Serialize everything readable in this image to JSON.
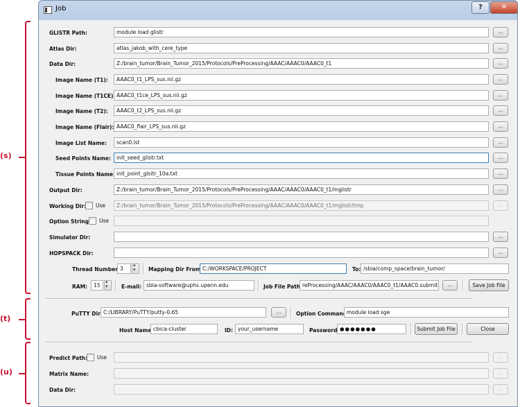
{
  "window": {
    "title": "Job"
  },
  "annotations": {
    "s": "(s)",
    "t": "(t)",
    "u": "(u)"
  },
  "browse_label": "...",
  "use_label": "Use",
  "rows": {
    "glistr_path": {
      "label": "GLISTR Path:",
      "value": "module load glistr"
    },
    "atlas_dir": {
      "label": "Atlas Dir:",
      "value": "atlas_jakob_with_cere_type"
    },
    "data_dir": {
      "label": "Data Dir:",
      "value": "Z:/brain_tumor/Brain_Tumor_2015/Protocols/PreProcessing/AAAC/AAAC0/AAAC0_t1"
    },
    "image_t1": {
      "label": "Image Name (T1):",
      "value": "AAAC0_t1_LPS_sus.nii.gz"
    },
    "image_t1ce": {
      "label": "Image Name (T1CE):",
      "value": "AAAC0_t1ce_LPS_sus.nii.gz"
    },
    "image_t2": {
      "label": "Image Name (T2):",
      "value": "AAAC0_t2_LPS_sus.nii.gz"
    },
    "image_flair": {
      "label": "Image Name (Flair):",
      "value": "AAAC0_flair_LPS_sus.nii.gz"
    },
    "image_list": {
      "label": "Image List Name:",
      "value": "scan0.lst"
    },
    "seed_points": {
      "label": "Seed Points Name:",
      "value": "init_seed_glistr.txt"
    },
    "tissue_points": {
      "label": "Tissue Points Name:",
      "value": "init_point_glsitr_10a.txt"
    },
    "output_dir": {
      "label": "Output Dir:",
      "value": "Z:/brain_tumor/Brain_Tumor_2015/Protocols/PreProcessing/AAAC/AAAC0/AAAC0_t1/mglistr"
    },
    "working_dir": {
      "label": "Working Dir:",
      "value": "Z:/brain_tumor/Brain_Tumor_2015/Protocols/PreProcessing/AAAC/AAAC0/AAAC0_t1/mglistr/tmp"
    },
    "option_string": {
      "label": "Option String:",
      "value": ""
    },
    "simulator_dir": {
      "label": "Simulator Dir:",
      "value": ""
    },
    "hopspack_dir": {
      "label": "HOPSPACK Dir:",
      "value": ""
    }
  },
  "thread": {
    "label": "Thread Number:",
    "value": "3"
  },
  "mapping_from": {
    "label": "Mapping Dir From:",
    "value": "C:/WORKSPACE/PROJECT"
  },
  "mapping_to": {
    "label": "To:",
    "value": "/sbia/comp_space/brain_tumor/"
  },
  "ram": {
    "label": "RAM:",
    "value": "15"
  },
  "email": {
    "label": "E-mail:",
    "value": "sbia-software@uphs.upenn.edu"
  },
  "job_file": {
    "label": "Job File Path:",
    "value": "reProcessing/AAAC/AAAC0/AAAC0_t1/AAAC0.submit"
  },
  "save_job_label": "Save Job File",
  "putty": {
    "label": "PuTTY Dir:",
    "value": "C:/LIBRARY/PuTTY/putty-0.65"
  },
  "option_command": {
    "label": "Option Command:",
    "value": "module load sge"
  },
  "host": {
    "label": "Host Name:",
    "value": "cbica-cluster"
  },
  "user_id": {
    "label": "ID:",
    "value": "your_username"
  },
  "password": {
    "label": "Password:",
    "value": "●●●●●●●"
  },
  "submit_label": "Submit Job File",
  "close_label": "Close",
  "predict_path": {
    "label": "Predict Path:",
    "value": ""
  },
  "matrix_name": {
    "label": "Matrix Name:",
    "value": ""
  },
  "predict_data_dir": {
    "label": "Data Dir:",
    "value": ""
  }
}
